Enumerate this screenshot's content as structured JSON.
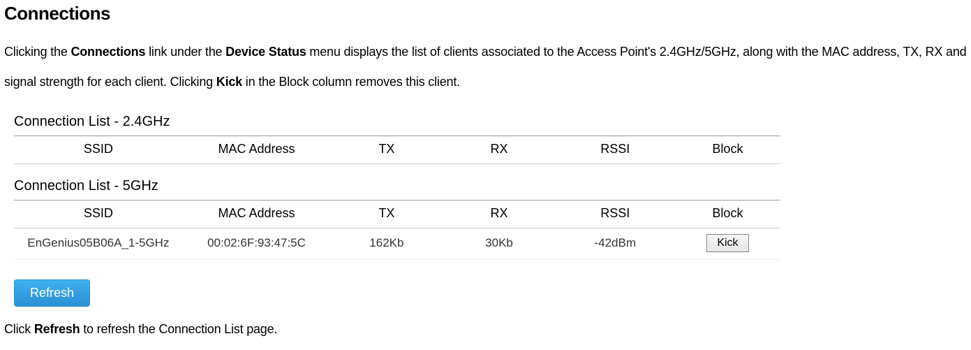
{
  "title": "Connections",
  "intro": {
    "pre1": "Clicking the ",
    "b1": "Connections",
    "mid1": " link under the ",
    "b2": "Device Status",
    "mid2": " menu displays the list of clients associated to the Access Point's 2.4GHz/5GHz, along with the MAC address, TX, RX and signal strength for each client. Clicking ",
    "b3": "Kick",
    "post1": " in the Block column removes this client."
  },
  "panel24": {
    "heading": "Connection List - 2.4GHz",
    "headers": [
      "SSID",
      "MAC Address",
      "TX",
      "RX",
      "RSSI",
      "Block"
    ]
  },
  "panel5": {
    "heading": "Connection List - 5GHz",
    "headers": [
      "SSID",
      "MAC Address",
      "TX",
      "RX",
      "RSSI",
      "Block"
    ],
    "row": {
      "ssid": "EnGenius05B06A_1-5GHz",
      "mac": "00:02:6F:93:47:5C",
      "tx": "162Kb",
      "rx": "30Kb",
      "rssi": "-42dBm",
      "kick_label": "Kick"
    }
  },
  "refresh_label": "Refresh",
  "footer": {
    "pre": "Click ",
    "b1": "Refresh",
    "post": " to refresh the Connection List page."
  }
}
